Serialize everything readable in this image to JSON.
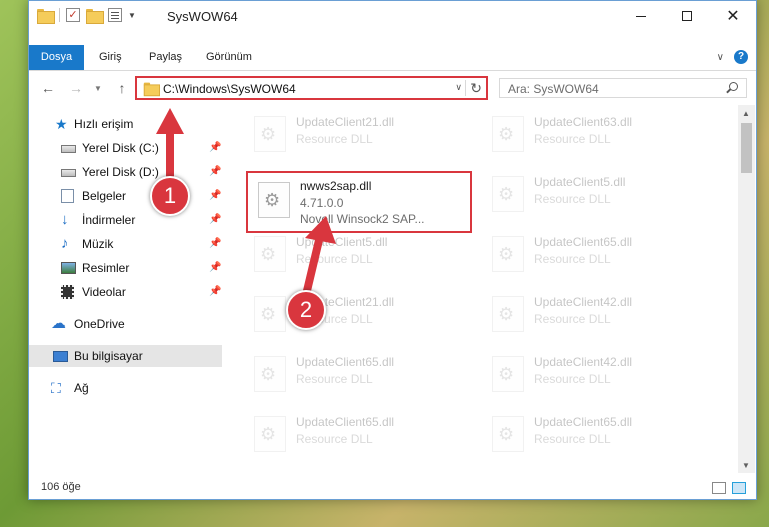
{
  "window": {
    "title": "SysWOW64",
    "minimize": "—",
    "maximize": "☐",
    "close": "✕"
  },
  "ribbon": {
    "tabs": [
      "Dosya",
      "Giriş",
      "Paylaş",
      "Görünüm"
    ],
    "help": "?"
  },
  "navbar": {
    "back": "←",
    "forward": "→",
    "up": "↑",
    "address": "C:\\Windows\\SysWOW64",
    "refresh": "↻",
    "search_placeholder": "Ara: SysWOW64"
  },
  "sidebar": {
    "items": [
      {
        "label": "Hızlı erişim",
        "icon": "star-icon",
        "pinned": false
      },
      {
        "label": "Yerel Disk (C:)",
        "icon": "drive-icon",
        "pinned": true
      },
      {
        "label": "Yerel Disk (D:)",
        "icon": "drive-icon",
        "pinned": true
      },
      {
        "label": "Belgeler",
        "icon": "documents-icon",
        "pinned": true
      },
      {
        "label": "İndirmeler",
        "icon": "downloads-icon",
        "pinned": true
      },
      {
        "label": "Müzik",
        "icon": "music-icon",
        "pinned": true
      },
      {
        "label": "Resimler",
        "icon": "pictures-icon",
        "pinned": true
      },
      {
        "label": "Videolar",
        "icon": "videos-icon",
        "pinned": true
      },
      {
        "label": "OneDrive",
        "icon": "cloud-icon",
        "pinned": false
      },
      {
        "label": "Bu bilgisayar",
        "icon": "pc-icon",
        "pinned": false,
        "selected": true
      },
      {
        "label": "Ağ",
        "icon": "network-icon",
        "pinned": false
      }
    ]
  },
  "files": {
    "left": [
      {
        "name": "UpdateClient21.dll",
        "type": "Resource DLL"
      },
      {
        "name": "nwws2sap.dll",
        "version": "4.71.0.0",
        "description": "Novell Winsock2 SAP..."
      },
      {
        "name": "UpdateClient5.dll",
        "type": "Resource DLL"
      },
      {
        "name": "UpdateClient21.dll",
        "type": "Resource DLL"
      },
      {
        "name": "UpdateClient65.dll",
        "type": "Resource DLL"
      },
      {
        "name": "UpdateClient65.dll",
        "type": "Resource DLL"
      }
    ],
    "right": [
      {
        "name": "UpdateClient63.dll",
        "type": "Resource DLL"
      },
      {
        "name": "UpdateClient5.dll",
        "type": "Resource DLL"
      },
      {
        "name": "UpdateClient65.dll",
        "type": "Resource DLL"
      },
      {
        "name": "UpdateClient42.dll",
        "type": "Resource DLL"
      },
      {
        "name": "UpdateClient42.dll",
        "type": "Resource DLL"
      },
      {
        "name": "UpdateClient65.dll",
        "type": "Resource DLL"
      }
    ]
  },
  "status": {
    "item_count": "106 öğe"
  },
  "annotations": {
    "step1": "1",
    "step2": "2",
    "color": "#d9363e"
  }
}
